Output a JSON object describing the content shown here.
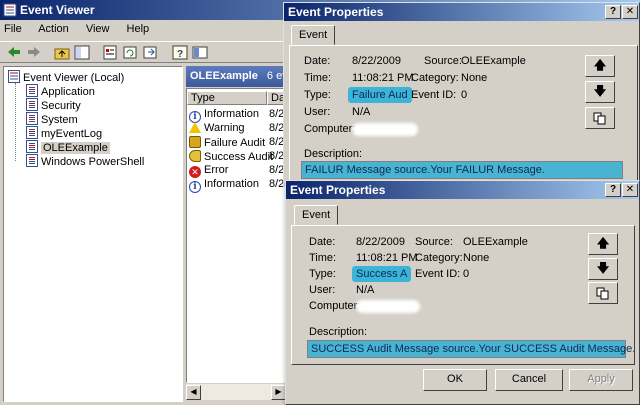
{
  "main_window": {
    "title": "Event Viewer",
    "menu": [
      "File",
      "Action",
      "View",
      "Help"
    ],
    "tree": {
      "root": "Event Viewer (Local)",
      "items": [
        "Application",
        "Security",
        "System",
        "myEventLog",
        "OLEExample",
        "Windows PowerShell"
      ],
      "selected": "OLEExample"
    },
    "panel_header": {
      "name": "OLEExample",
      "count": "6 ev"
    },
    "columns": [
      "Type",
      "Da"
    ],
    "rows": [
      {
        "type": "Information",
        "date": "8/2",
        "icon": "information-icon"
      },
      {
        "type": "Warning",
        "date": "8/2",
        "icon": "warning-icon"
      },
      {
        "type": "Failure Audit",
        "date": "8/2",
        "icon": "lock-icon"
      },
      {
        "type": "Success Audit",
        "date": "8/2",
        "icon": "key-icon"
      },
      {
        "type": "Error",
        "date": "8/2",
        "icon": "error-icon"
      },
      {
        "type": "Information",
        "date": "8/2",
        "icon": "information-icon"
      }
    ]
  },
  "dialog1": {
    "title": "Event Properties",
    "tab": "Event",
    "date_label": "Date:",
    "date": "8/22/2009",
    "time_label": "Time:",
    "time": "11:08:21 PM",
    "type_label": "Type:",
    "type": "Failure Aud",
    "user_label": "User:",
    "user": "N/A",
    "computer_label": "Computer:",
    "source_label": "Source:",
    "source": "OLEExample",
    "category_label": "Category:",
    "category": "None",
    "eventid_label": "Event ID:",
    "eventid": "0",
    "description_label": "Description:",
    "description": "FAILUR Message source.Your FAILUR Message."
  },
  "dialog2": {
    "title": "Event Properties",
    "tab": "Event",
    "date_label": "Date:",
    "date": "8/22/2009",
    "time_label": "Time:",
    "time": "11:08:21 PM",
    "type_label": "Type:",
    "type": "Success A",
    "user_label": "User:",
    "user": "N/A",
    "computer_label": "Computer:",
    "source_label": "Source:",
    "source": "OLEExample",
    "category_label": "Category:",
    "category": "None",
    "eventid_label": "Event ID:",
    "eventid": "0",
    "description_label": "Description:",
    "description": "SUCCESS Audit Message source.Your SUCCESS Audit Message.",
    "buttons": {
      "ok": "OK",
      "cancel": "Cancel",
      "apply": "Apply"
    }
  },
  "colors": {
    "title_active": "#0a246a",
    "highlight": "#3bb4d8",
    "face": "#d4d0c8"
  }
}
